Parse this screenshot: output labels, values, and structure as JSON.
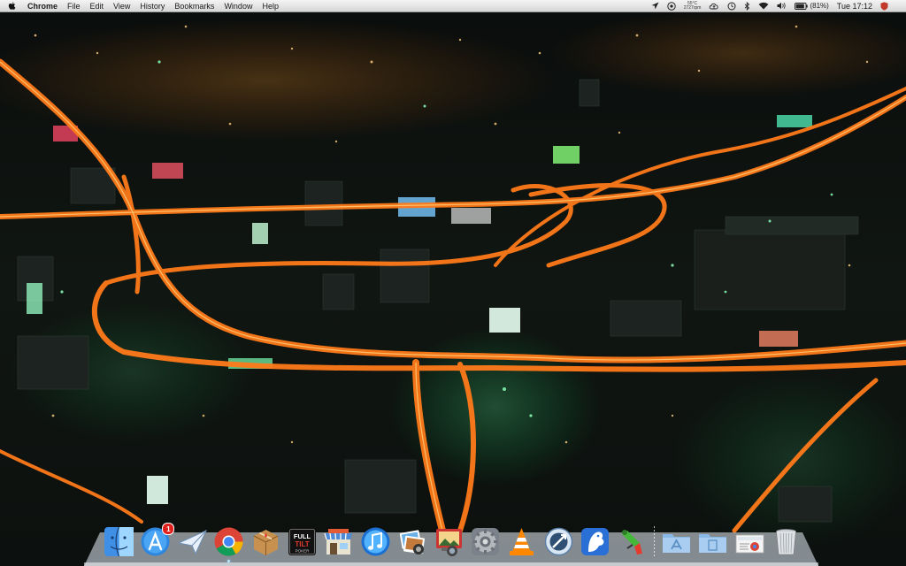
{
  "menubar": {
    "app_name": "Chrome",
    "menus": [
      "File",
      "Edit",
      "View",
      "History",
      "Bookmarks",
      "Window",
      "Help"
    ],
    "status": {
      "temperature_top": "55°C",
      "temperature_bottom": "2727rpm",
      "battery": "(81%)",
      "clock": "Tue 17:12"
    }
  },
  "dock": {
    "items": [
      {
        "name": "Finder",
        "icon": "finder-icon"
      },
      {
        "name": "App Store",
        "icon": "app-store-icon",
        "badge": "1"
      },
      {
        "name": "Mail",
        "icon": "mail-icon"
      },
      {
        "name": "Google Chrome",
        "icon": "chrome-icon",
        "running": true
      },
      {
        "name": "Box",
        "icon": "box-icon"
      },
      {
        "name": "Full Tilt Poker",
        "icon": "full-tilt-poker-icon",
        "label": "FULL TILT POKER"
      },
      {
        "name": "Store",
        "icon": "store-icon"
      },
      {
        "name": "iTunes",
        "icon": "itunes-icon"
      },
      {
        "name": "iPhoto",
        "icon": "iphoto-icon"
      },
      {
        "name": "Photo Booth",
        "icon": "photo-booth-icon"
      },
      {
        "name": "System Preferences",
        "icon": "system-preferences-icon"
      },
      {
        "name": "VLC",
        "icon": "vlc-icon"
      },
      {
        "name": "Migration",
        "icon": "migration-icon"
      },
      {
        "name": "Adium",
        "icon": "adium-icon"
      },
      {
        "name": "Squirrel",
        "icon": "squirrel-icon"
      }
    ],
    "stack_items": [
      {
        "name": "Applications",
        "icon": "applications-folder-icon"
      },
      {
        "name": "Documents",
        "icon": "documents-folder-icon"
      },
      {
        "name": "Downloads",
        "icon": "downloads-stack-icon"
      },
      {
        "name": "Trash",
        "icon": "trash-icon"
      }
    ]
  },
  "colors": {
    "highway": "#ff7a1a",
    "city_green": "#3cff8a",
    "sky": "#06090a"
  }
}
